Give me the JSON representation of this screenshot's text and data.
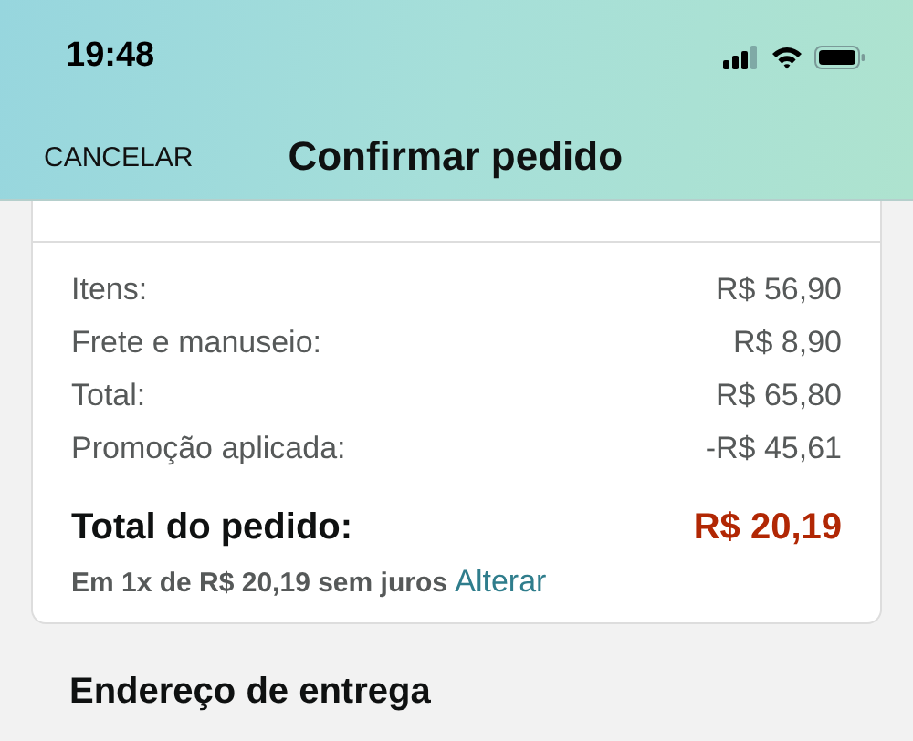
{
  "status_bar": {
    "time": "19:48"
  },
  "nav": {
    "cancel": "CANCELAR",
    "title": "Confirmar pedido"
  },
  "summary": {
    "rows": [
      {
        "label": "Itens:",
        "value": "R$ 56,90"
      },
      {
        "label": "Frete e manuseio:",
        "value": "R$ 8,90"
      },
      {
        "label": "Total:",
        "value": "R$ 65,80"
      },
      {
        "label": "Promoção aplicada:",
        "value": "-R$ 45,61"
      }
    ],
    "order_total": {
      "label": "Total do pedido:",
      "value": "R$ 20,19"
    },
    "installments": {
      "text": "Em 1x de R$ 20,19 sem juros",
      "link": "Alterar"
    }
  },
  "delivery": {
    "heading": "Endereço de entrega"
  }
}
